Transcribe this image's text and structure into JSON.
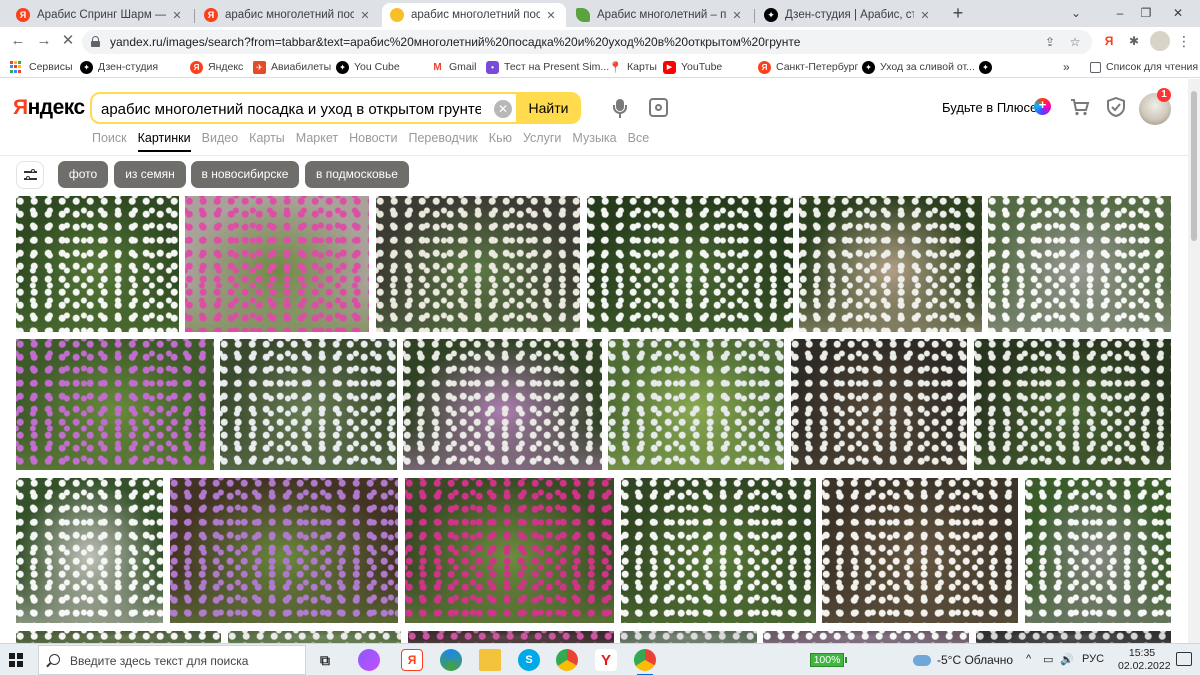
{
  "browser": {
    "tabs": [
      {
        "title": "Арабис Спринг Шарм — Яндекс",
        "favicon": "ya"
      },
      {
        "title": "арабис многолетний посадка и",
        "favicon": "ya"
      },
      {
        "title": "арабис многолетний посадка и",
        "favicon": "img",
        "active": true
      },
      {
        "title": "Арабис многолетний – посадка",
        "favicon": "green"
      },
      {
        "title": "Дзен-студия | Арабис, старый и",
        "favicon": "zen"
      }
    ],
    "new_tab": "+",
    "window_controls": [
      "⌄",
      "–",
      "❐",
      "✕"
    ],
    "url": "yandex.ru/images/search?from=tabbar&text=арабис%20многолетний%20посадка%20и%20уход%20в%20открытом%20грунте",
    "bookmarks": [
      {
        "label": "Сервисы",
        "icon": "apps-grid-icon"
      },
      {
        "label": "Дзен-студия",
        "icon": "zen-icon"
      },
      {
        "label": "Яндекс",
        "icon": "yandex-icon"
      },
      {
        "label": "Авиабилеты",
        "icon": "plane-icon"
      },
      {
        "label": "You Cube",
        "icon": "zen-icon"
      },
      {
        "label": "Gmail",
        "icon": "gmail-icon"
      },
      {
        "label": "Тест на Present Sim...",
        "icon": "chat-icon"
      },
      {
        "label": "Карты",
        "icon": "maps-pin-icon"
      },
      {
        "label": "YouTube",
        "icon": "youtube-icon"
      },
      {
        "label": "Санкт-Петербург",
        "icon": "yandex-icon"
      },
      {
        "label": "Уход за сливой от...",
        "icon": "zen-icon"
      },
      {
        "label": "",
        "icon": "zen-icon"
      }
    ],
    "bookmarks_more": "»",
    "reading_list": "Список для чтения"
  },
  "yandex": {
    "logo_first": "Я",
    "logo_rest": "ндекс",
    "query": "арабис многолетний посадка и уход в открытом грунте",
    "clear": "✕",
    "find_label": "Найти",
    "plus_text": "Будьте в Плюсе",
    "notif_count": "1",
    "services": [
      "Поиск",
      "Картинки",
      "Видео",
      "Карты",
      "Маркет",
      "Новости",
      "Переводчик",
      "Кью",
      "Услуги",
      "Музыка",
      "Все"
    ],
    "active_service": "Картинки",
    "chips": [
      "фото",
      "из семян",
      "в новосибирске",
      "в подмосковье"
    ]
  },
  "images": [
    {
      "name": "white-arabis-1",
      "palette": [
        "#2f4a22",
        "#ffffff",
        "#5b7d3a"
      ]
    },
    {
      "name": "pink-aubrieta-gravel",
      "palette": [
        "#a9a29a",
        "#e04aa8",
        "#6b8a3e"
      ]
    },
    {
      "name": "white-arabis-rocks",
      "palette": [
        "#3b3a33",
        "#f4f2e8",
        "#5d7d45"
      ]
    },
    {
      "name": "white-arabis-dense",
      "palette": [
        "#263b1c",
        "#ffffff",
        "#4e6d35"
      ]
    },
    {
      "name": "white-arabis-boulder",
      "palette": [
        "#2c4020",
        "#f8f8f4",
        "#b9a58c"
      ]
    },
    {
      "name": "white-arabis-stone",
      "palette": [
        "#556b45",
        "#ffffff",
        "#9c9c98"
      ]
    },
    {
      "name": "purple-arabis",
      "palette": [
        "#3e5a2a",
        "#c86fd6",
        "#6a8e3c"
      ]
    },
    {
      "name": "white-arabis-cushion",
      "palette": [
        "#3a4a2e",
        "#f2f4f8",
        "#6b7f56"
      ]
    },
    {
      "name": "white-arabis-garden",
      "palette": [
        "#2f4223",
        "#f3f2ef",
        "#b482b8"
      ]
    },
    {
      "name": "white-arabis-lawn",
      "palette": [
        "#4f6d34",
        "#eef0f4",
        "#8fae55"
      ]
    },
    {
      "name": "white-arabis-mound",
      "palette": [
        "#2e2a24",
        "#f6f7f2",
        "#5a4d3d"
      ]
    },
    {
      "name": "white-arabis-bush",
      "palette": [
        "#29361f",
        "#f4f5f1",
        "#4e6a37"
      ]
    },
    {
      "name": "white-arabis-clump",
      "palette": [
        "#34512a",
        "#ffffff",
        "#c9c7c1"
      ]
    },
    {
      "name": "lilac-arabis",
      "palette": [
        "#433324",
        "#b57ed6",
        "#6b8e3e"
      ]
    },
    {
      "name": "magenta-aubrieta",
      "palette": [
        "#3a4a26",
        "#d8338f",
        "#6f9240"
      ]
    },
    {
      "name": "white-arabis-wide",
      "palette": [
        "#304522",
        "#ffffff",
        "#5e7f3b"
      ]
    },
    {
      "name": "white-arabis-closeup",
      "palette": [
        "#3c3429",
        "#fbfbf7",
        "#6a5a44"
      ]
    },
    {
      "name": "white-arabis-tall",
      "palette": [
        "#3a5c2b",
        "#ffffff",
        "#8a8a86"
      ]
    },
    {
      "name": "arabis-partial-1",
      "palette": [
        "#4a5b3a",
        "#ffffff",
        "#6c7c56"
      ]
    },
    {
      "name": "arabis-partial-2",
      "palette": [
        "#556b44",
        "#f2f2f2",
        "#768a5e"
      ]
    },
    {
      "name": "arabis-partial-3",
      "palette": [
        "#3b2b30",
        "#d45aa8",
        "#5b4c48"
      ]
    },
    {
      "name": "arabis-partial-4",
      "palette": [
        "#5b6b5a",
        "#e0e0e0",
        "#7c8a78"
      ]
    },
    {
      "name": "arabis-partial-5",
      "palette": [
        "#6b5a6a",
        "#ffffff",
        "#8a7a8a"
      ]
    },
    {
      "name": "arabis-partial-6",
      "palette": [
        "#2f2f2f",
        "#e0e0e0",
        "#555555"
      ]
    }
  ],
  "taskbar": {
    "search_placeholder": "Введите здесь текст для поиска",
    "apps": [
      "task-view-icon",
      "alice-icon",
      "yandex-browser-icon",
      "edge-icon",
      "file-explorer-icon",
      "skype-icon",
      "chrome-icon",
      "yandex-y-icon",
      "chrome-icon"
    ],
    "battery": "100%",
    "weather": "-5°C  Облачно",
    "tray_symbols": [
      "^",
      "▭",
      "🔊"
    ],
    "lang": "РУС",
    "time": "15:35",
    "date": "02.02.2022"
  }
}
